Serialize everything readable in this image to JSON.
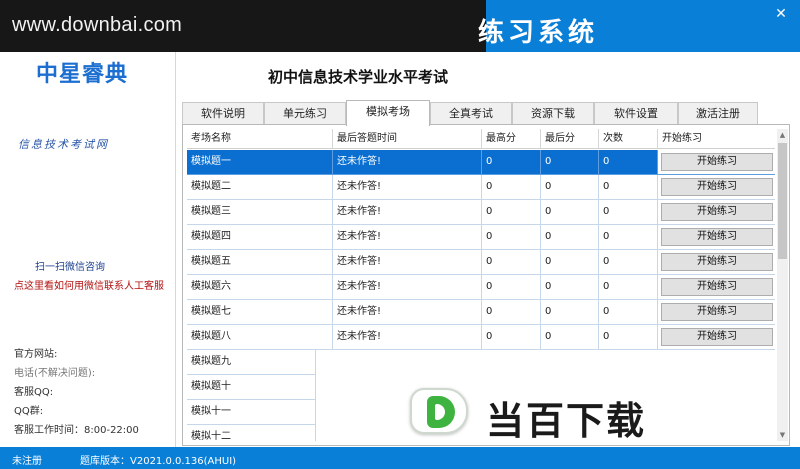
{
  "watermark": "www.downbai.com",
  "app_title": "练习系统",
  "close_glyph": "✕",
  "sidebar": {
    "logo": "中星睿典",
    "slogan": "信息技术考试网",
    "scan_link": "扫一扫微信咨询",
    "help_link": "点这里看如何用微信联系人工客服",
    "website": "官方网站:",
    "phone": "电话(不解决问题):",
    "service_qq": "客服QQ:",
    "qq_group": "QQ群:",
    "hours": "客服工作时间：8:00-22:00"
  },
  "exam_title": "初中信息技术学业水平考试",
  "tabs": [
    "软件说明",
    "单元练习",
    "模拟考场",
    "全真考试",
    "资源下载",
    "软件设置",
    "激活注册"
  ],
  "active_tab": "模拟考场",
  "table": {
    "headers": [
      "考场名称",
      "最后答题时间",
      "最高分",
      "最后分",
      "次数",
      "开始练习"
    ],
    "button_label": "开始练习",
    "rows": [
      [
        "模拟题一",
        "还未作答!",
        "0",
        "0",
        "0"
      ],
      [
        "模拟题二",
        "还未作答!",
        "0",
        "0",
        "0"
      ],
      [
        "模拟题三",
        "还未作答!",
        "0",
        "0",
        "0"
      ],
      [
        "模拟题四",
        "还未作答!",
        "0",
        "0",
        "0"
      ],
      [
        "模拟题五",
        "还未作答!",
        "0",
        "0",
        "0"
      ],
      [
        "模拟题六",
        "还未作答!",
        "0",
        "0",
        "0"
      ],
      [
        "模拟题七",
        "还未作答!",
        "0",
        "0",
        "0"
      ],
      [
        "模拟题八",
        "还未作答!",
        "0",
        "0",
        "0"
      ],
      [
        "模拟题九",
        "",
        "",
        "",
        ""
      ],
      [
        "模拟题十",
        "",
        "",
        "",
        ""
      ],
      [
        "模拟十一",
        "",
        "",
        "",
        ""
      ],
      [
        "模拟十二",
        "",
        "",
        "",
        ""
      ]
    ]
  },
  "status": {
    "registration": "未注册",
    "version": "题库版本：V2021.0.0.136(AHUI)"
  },
  "brand_overlay": "当百下载",
  "colors": {
    "accent": "#0a7fd8",
    "selected_row": "#0a6fd1",
    "help_link": "#b31212"
  }
}
